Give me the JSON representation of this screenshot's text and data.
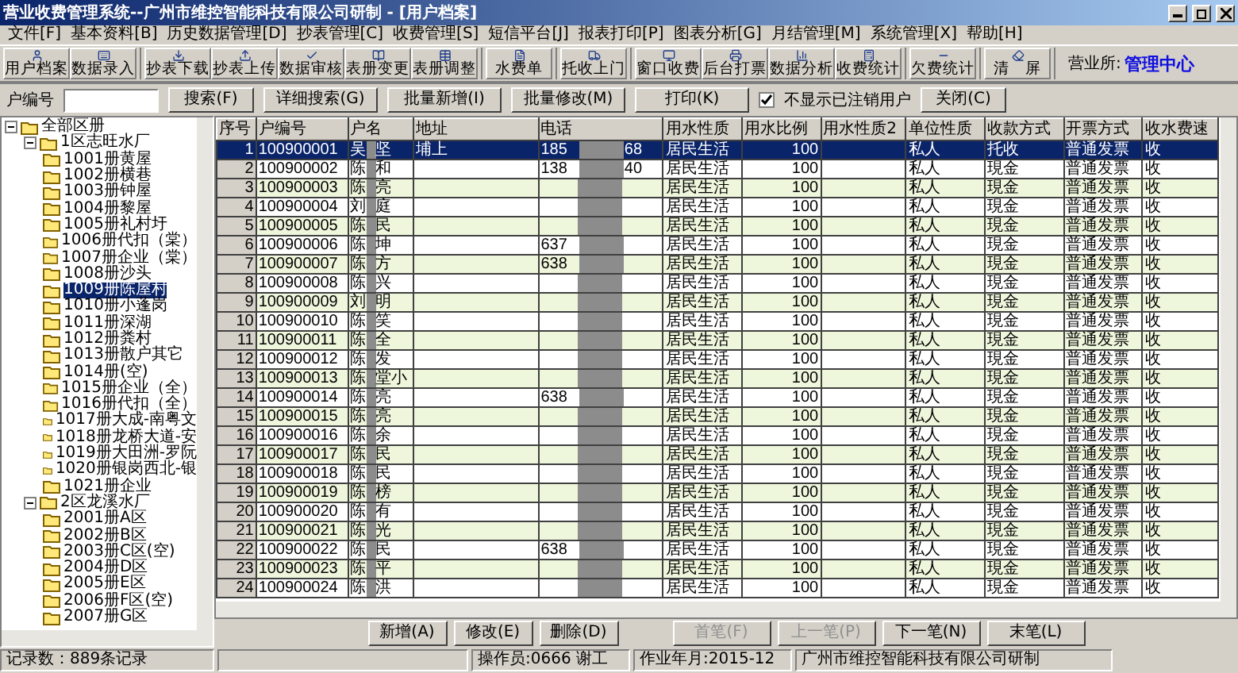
{
  "window": {
    "title": "营业收费管理系统--广州市维控智能科技有限公司研制 - [用户档案]"
  },
  "menu": [
    "文件[F]",
    "基本资料[B]",
    "历史数据管理[D]",
    "抄表管理[C]",
    "收费管理[S]",
    "短信平台[J]",
    "报表打印[P]",
    "图表分析[G]",
    "月结管理[M]",
    "系统管理[X]",
    "帮助[H]"
  ],
  "toolbar_groups": [
    [
      "用户档案",
      "数据录入"
    ],
    [
      "抄表下载",
      "抄表上传",
      "数据审核",
      "表册变更",
      "表册调整"
    ],
    [
      "水费单"
    ],
    [
      "托收上门"
    ],
    [
      "窗口收费",
      "后台打票",
      "数据分析",
      "收费统计"
    ],
    [
      "欠费统计"
    ],
    [
      "清　屏"
    ]
  ],
  "office": {
    "label": "营业所:",
    "value": "管理中心"
  },
  "search": {
    "label": "户编号",
    "buttons": [
      "搜索(F)",
      "详细搜索(G)",
      "批量新增(I)",
      "批量修改(M)",
      "打印(K)"
    ],
    "checkbox": {
      "label": "不显示已注销用户",
      "checked": true
    },
    "close": "关闭(C)"
  },
  "tree": {
    "label": "全部区册",
    "expanded": true,
    "selected": false,
    "children": [
      {
        "label": "1区志旺水厂",
        "expanded": true,
        "selected": false,
        "children": [
          {
            "label": "1001册黄屋",
            "selected": false
          },
          {
            "label": "1002册横巷",
            "selected": false
          },
          {
            "label": "1003册钟屋",
            "selected": false
          },
          {
            "label": "1004册黎屋",
            "selected": false
          },
          {
            "label": "1005册礼村圩",
            "selected": false
          },
          {
            "label": "1006册代扣（棠）",
            "selected": false
          },
          {
            "label": "1007册企业（棠）",
            "selected": false
          },
          {
            "label": "1008册沙头",
            "selected": false
          },
          {
            "label": "1009册陈屋村",
            "selected": true
          },
          {
            "label": "1010册小蓬岗",
            "selected": false
          },
          {
            "label": "1011册深湖",
            "selected": false
          },
          {
            "label": "1012册粪村",
            "selected": false
          },
          {
            "label": "1013册散户其它",
            "selected": false
          },
          {
            "label": "1014册(空)",
            "selected": false
          },
          {
            "label": "1015册企业（全）",
            "selected": false
          },
          {
            "label": "1016册代扣（全）",
            "selected": false
          },
          {
            "label": "1017册大成-南粤文",
            "selected": false
          },
          {
            "label": "1018册龙桥大道-安",
            "selected": false
          },
          {
            "label": "1019册大田洲-罗阮",
            "selected": false
          },
          {
            "label": "1020册银岗西北-银",
            "selected": false
          },
          {
            "label": "1021册企业",
            "selected": false
          }
        ]
      },
      {
        "label": "2区龙溪水厂",
        "expanded": true,
        "selected": false,
        "children": [
          {
            "label": "2001册A区",
            "selected": false
          },
          {
            "label": "2002册B区",
            "selected": false
          },
          {
            "label": "2003册C区(空)",
            "selected": false
          },
          {
            "label": "2004册D区",
            "selected": false
          },
          {
            "label": "2005册E区",
            "selected": false
          },
          {
            "label": "2006册F区(空)",
            "selected": false
          },
          {
            "label": "2007册G区",
            "selected": false
          }
        ]
      }
    ]
  },
  "table": {
    "columns": [
      "序号",
      "户编号",
      "户名",
      "地址",
      "电话",
      "用水性质",
      "用水比例",
      "用水性质2",
      "单位性质",
      "收款方式",
      "开票方式",
      "收水费速"
    ],
    "rows": [
      {
        "seq": "1",
        "id": "100900001",
        "name_start": "吴",
        "name_end": "坚",
        "address": "埔上",
        "phone_start": "185",
        "phone_end": "68",
        "use": "居民生活",
        "ratio": "100",
        "unit": "私人",
        "payment": "托收",
        "invoice": "普通发票",
        "fee": "收",
        "selected": true
      },
      {
        "seq": "2",
        "id": "100900002",
        "name_start": "陈",
        "name_end": "和",
        "phone_start": "138",
        "phone_end": "40",
        "use": "居民生活",
        "ratio": "100",
        "unit": "私人",
        "payment": "現金",
        "invoice": "普通发票",
        "fee": "收",
        "selected": false
      },
      {
        "seq": "3",
        "id": "100900003",
        "name_start": "陈",
        "name_end": "亮",
        "use": "居民生活",
        "ratio": "100",
        "unit": "私人",
        "payment": "現金",
        "invoice": "普通发票",
        "fee": "收",
        "selected": false
      },
      {
        "seq": "4",
        "id": "100900004",
        "name_start": "刘",
        "name_end": "庭",
        "use": "居民生活",
        "ratio": "100",
        "unit": "私人",
        "payment": "現金",
        "invoice": "普通发票",
        "fee": "收",
        "selected": false
      },
      {
        "seq": "5",
        "id": "100900005",
        "name_start": "陈",
        "name_end": "民",
        "use": "居民生活",
        "ratio": "100",
        "unit": "私人",
        "payment": "現金",
        "invoice": "普通发票",
        "fee": "收",
        "selected": false
      },
      {
        "seq": "6",
        "id": "100900006",
        "name_start": "陈",
        "name_end": "坤",
        "phone_start": "637",
        "use": "居民生活",
        "ratio": "100",
        "unit": "私人",
        "payment": "現金",
        "invoice": "普通发票",
        "fee": "收",
        "selected": false
      },
      {
        "seq": "7",
        "id": "100900007",
        "name_start": "陈",
        "name_end": "方",
        "phone_start": "638",
        "use": "居民生活",
        "ratio": "100",
        "unit": "私人",
        "payment": "現金",
        "invoice": "普通发票",
        "fee": "收",
        "selected": false
      },
      {
        "seq": "8",
        "id": "100900008",
        "name_start": "陈",
        "name_end": "兴",
        "use": "居民生活",
        "ratio": "100",
        "unit": "私人",
        "payment": "現金",
        "invoice": "普通发票",
        "fee": "收",
        "selected": false
      },
      {
        "seq": "9",
        "id": "100900009",
        "name_start": "刘",
        "name_end": "明",
        "use": "居民生活",
        "ratio": "100",
        "unit": "私人",
        "payment": "現金",
        "invoice": "普通发票",
        "fee": "收",
        "selected": false
      },
      {
        "seq": "10",
        "id": "100900010",
        "name_start": "陈",
        "name_end": "笑",
        "use": "居民生活",
        "ratio": "100",
        "unit": "私人",
        "payment": "現金",
        "invoice": "普通发票",
        "fee": "收",
        "selected": false
      },
      {
        "seq": "11",
        "id": "100900011",
        "name_start": "陈",
        "name_end": "全",
        "use": "居民生活",
        "ratio": "100",
        "unit": "私人",
        "payment": "現金",
        "invoice": "普通发票",
        "fee": "收",
        "selected": false
      },
      {
        "seq": "12",
        "id": "100900012",
        "name_start": "陈",
        "name_end": "发",
        "use": "居民生活",
        "ratio": "100",
        "unit": "私人",
        "payment": "現金",
        "invoice": "普通发票",
        "fee": "收",
        "selected": false
      },
      {
        "seq": "13",
        "id": "100900013",
        "name_start": "陈",
        "name_end": "堂小",
        "use": "居民生活",
        "ratio": "100",
        "unit": "私人",
        "payment": "現金",
        "invoice": "普通发票",
        "fee": "收",
        "selected": false
      },
      {
        "seq": "14",
        "id": "100900014",
        "name_start": "陈",
        "name_end": "亮",
        "phone_start": "638",
        "use": "居民生活",
        "ratio": "100",
        "unit": "私人",
        "payment": "現金",
        "invoice": "普通发票",
        "fee": "收",
        "selected": false
      },
      {
        "seq": "15",
        "id": "100900015",
        "name_start": "陈",
        "name_end": "亮",
        "use": "居民生活",
        "ratio": "100",
        "unit": "私人",
        "payment": "現金",
        "invoice": "普通发票",
        "fee": "收",
        "selected": false
      },
      {
        "seq": "16",
        "id": "100900016",
        "name_start": "陈",
        "name_end": "余",
        "use": "居民生活",
        "ratio": "100",
        "unit": "私人",
        "payment": "現金",
        "invoice": "普通发票",
        "fee": "收",
        "selected": false
      },
      {
        "seq": "17",
        "id": "100900017",
        "name_start": "陈",
        "name_end": "民",
        "use": "居民生活",
        "ratio": "100",
        "unit": "私人",
        "payment": "現金",
        "invoice": "普通发票",
        "fee": "收",
        "selected": false
      },
      {
        "seq": "18",
        "id": "100900018",
        "name_start": "陈",
        "name_end": "民",
        "use": "居民生活",
        "ratio": "100",
        "unit": "私人",
        "payment": "現金",
        "invoice": "普通发票",
        "fee": "收",
        "selected": false
      },
      {
        "seq": "19",
        "id": "100900019",
        "name_start": "陈",
        "name_end": "榜",
        "use": "居民生活",
        "ratio": "100",
        "unit": "私人",
        "payment": "現金",
        "invoice": "普通发票",
        "fee": "收",
        "selected": false
      },
      {
        "seq": "20",
        "id": "100900020",
        "name_start": "陈",
        "name_end": "有",
        "use": "居民生活",
        "ratio": "100",
        "unit": "私人",
        "payment": "現金",
        "invoice": "普通发票",
        "fee": "收",
        "selected": false
      },
      {
        "seq": "21",
        "id": "100900021",
        "name_start": "陈",
        "name_end": "光",
        "use": "居民生活",
        "ratio": "100",
        "unit": "私人",
        "payment": "現金",
        "invoice": "普通发票",
        "fee": "收",
        "selected": false
      },
      {
        "seq": "22",
        "id": "100900022",
        "name_start": "陈",
        "name_end": "民",
        "phone_start": "638",
        "use": "居民生活",
        "ratio": "100",
        "unit": "私人",
        "payment": "現金",
        "invoice": "普通发票",
        "fee": "收",
        "selected": false
      },
      {
        "seq": "23",
        "id": "100900023",
        "name_start": "陈",
        "name_end": "平",
        "use": "居民生活",
        "ratio": "100",
        "unit": "私人",
        "payment": "現金",
        "invoice": "普通发票",
        "fee": "收",
        "selected": false
      },
      {
        "seq": "24",
        "id": "100900024",
        "name_start": "陈",
        "name_end": "洪",
        "use": "居民生活",
        "ratio": "100",
        "unit": "私人",
        "payment": "現金",
        "invoice": "普通发票",
        "fee": "收",
        "selected": false
      }
    ]
  },
  "actions": [
    {
      "label": "新增(A)",
      "disabled": false
    },
    {
      "label": "修改(E)",
      "disabled": false
    },
    {
      "label": "删除(D)",
      "disabled": false
    },
    {
      "label": "首笔(F)",
      "disabled": true
    },
    {
      "label": "上一笔(P)",
      "disabled": true
    },
    {
      "label": "下一笔(N)",
      "disabled": false
    },
    {
      "label": "末笔(L)",
      "disabled": false
    }
  ],
  "status_bar": [
    "记录数：889条记录",
    "操作员:0666 谢工",
    "作业年月:2015-12",
    "广州市维控智能科技有限公司研制"
  ]
}
